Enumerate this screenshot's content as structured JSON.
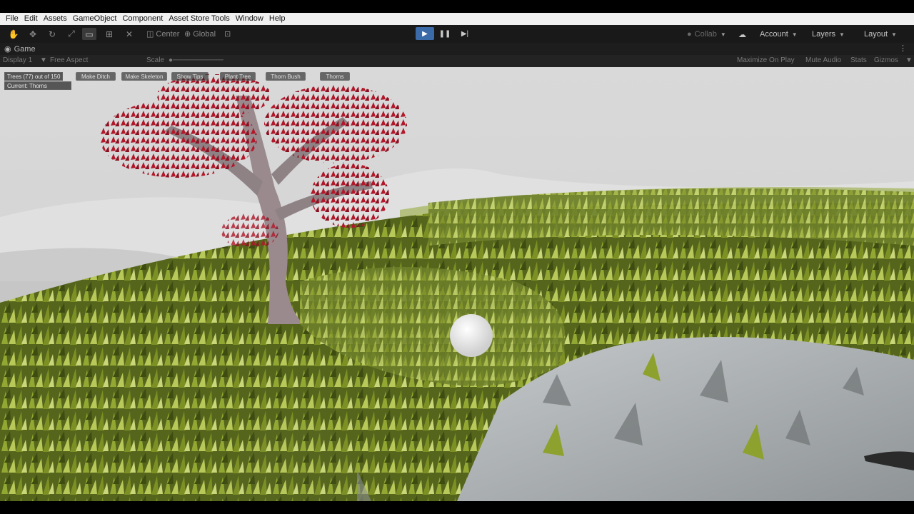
{
  "menubar": {
    "items": [
      "File",
      "Edit",
      "Assets",
      "GameObject",
      "Component",
      "Asset Store Tools",
      "Window",
      "Help"
    ]
  },
  "toolbar": {
    "pivot_mode": "Center",
    "pivot_rotation": "Global",
    "collab_label": "Collab",
    "account_label": "Account",
    "layers_label": "Layers",
    "layout_label": "Layout"
  },
  "game_panel": {
    "tab_label": "Game",
    "display": "Display 1",
    "aspect": "Free Aspect",
    "scale_label": "Scale",
    "maximize_on_play": "Maximize On Play",
    "mute_audio": "Mute Audio",
    "stats": "Stats",
    "gizmos": "Gizmos"
  },
  "hud": {
    "trees_counter": "Trees (77) out of 150",
    "buttons": [
      "Make Ditch",
      "Make Skeleton",
      "Show Tips",
      "Plant Tree",
      "Thorn Bush",
      "Thorns"
    ],
    "current_label": "Current: Thorns"
  },
  "colors": {
    "play_active": "#3a6aa8",
    "tree_foliage": "#b01a2a",
    "grass": "#7c8f24",
    "ground": "#b9bdbf",
    "sky": "#d6d6d6"
  }
}
